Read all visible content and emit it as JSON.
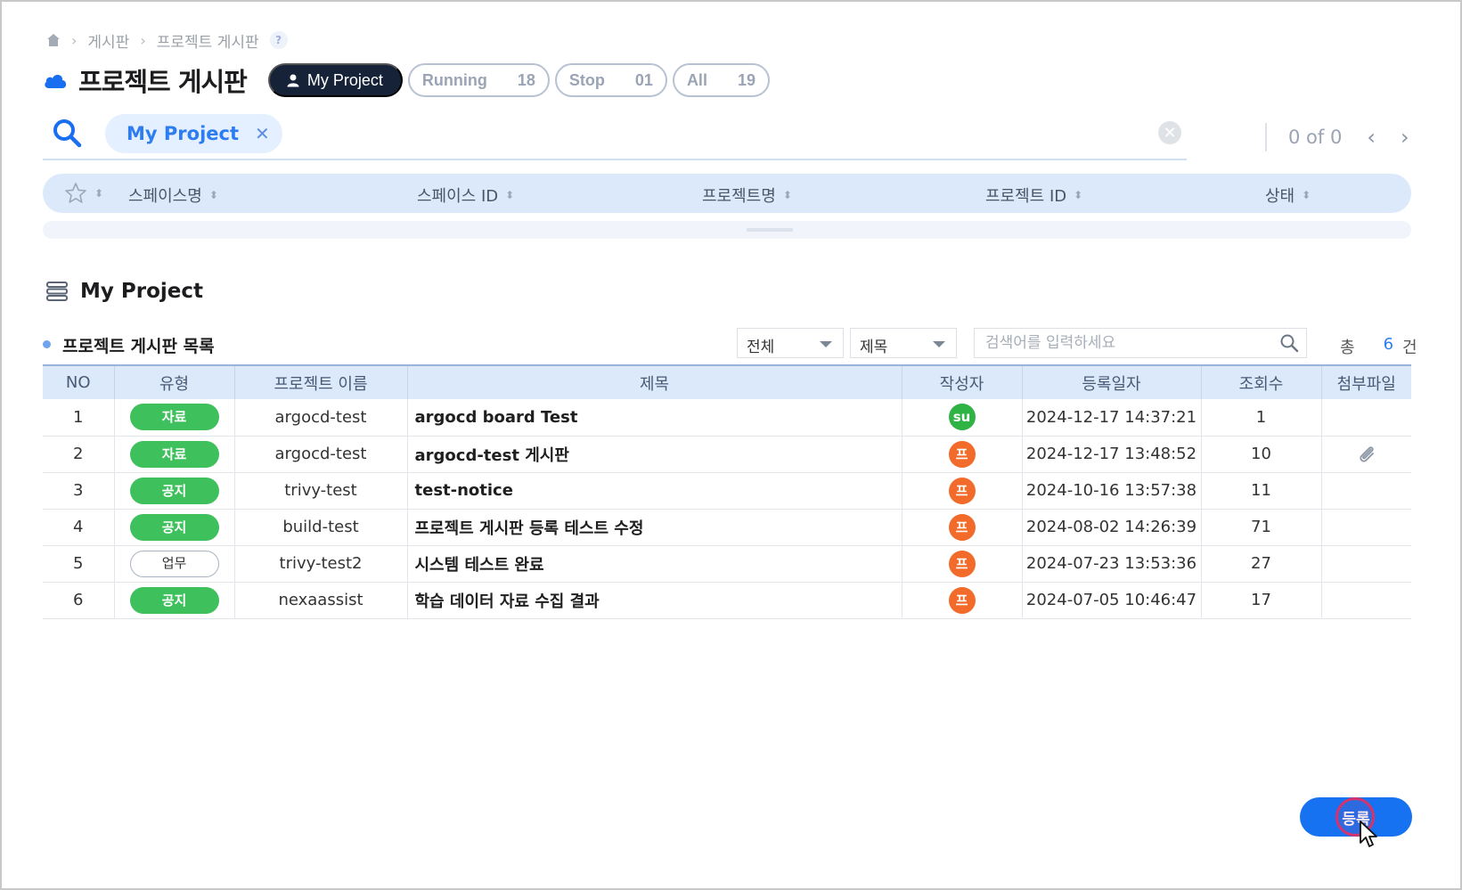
{
  "breadcrumb": {
    "items": [
      "게시판",
      "프로젝트 게시판"
    ],
    "help": "?"
  },
  "header": {
    "title": "프로젝트 게시판",
    "filters": {
      "my_project": "My Project",
      "running": {
        "label": "Running",
        "count": "18"
      },
      "stop": {
        "label": "Stop",
        "count": "01"
      },
      "all": {
        "label": "All",
        "count": "19"
      }
    }
  },
  "search": {
    "chip": "My Project",
    "pager": "0 of 0"
  },
  "columns": {
    "space_name": "스페이스명",
    "space_id": "스페이스 ID",
    "project_name": "프로젝트명",
    "project_id": "프로젝트 ID",
    "status": "상태"
  },
  "section": {
    "title": "My Project",
    "list_label": "프로젝트 게시판 목록",
    "filter_scope": "전체",
    "filter_field": "제목",
    "search_placeholder": "검색어를 입력하세요",
    "total_prefix": "총",
    "total_count": "6",
    "total_suffix": "건"
  },
  "table": {
    "headers": [
      "NO",
      "유형",
      "프로젝트 이름",
      "제목",
      "작성자",
      "등록일자",
      "조회수",
      "첨부파일"
    ],
    "rows": [
      {
        "no": "1",
        "type": "자료",
        "project": "argocd-test",
        "subject": "argocd board Test",
        "author": "su",
        "author_color": "#2fb344",
        "date": "2024-12-17 14:37:21",
        "views": "1",
        "attachment": false
      },
      {
        "no": "2",
        "type": "자료",
        "project": "argocd-test",
        "subject": "argocd-test 게시판",
        "author": "프",
        "author_color": "#f26b2a",
        "date": "2024-12-17 13:48:52",
        "views": "10",
        "attachment": true
      },
      {
        "no": "3",
        "type": "공지",
        "project": "trivy-test",
        "subject": "test-notice",
        "author": "프",
        "author_color": "#f26b2a",
        "date": "2024-10-16 13:57:38",
        "views": "11",
        "attachment": false
      },
      {
        "no": "4",
        "type": "공지",
        "project": "build-test",
        "subject": "프로젝트 게시판 등록 테스트 수정",
        "author": "프",
        "author_color": "#f26b2a",
        "date": "2024-08-02 14:26:39",
        "views": "71",
        "attachment": false
      },
      {
        "no": "5",
        "type": "업무",
        "project": "trivy-test2",
        "subject": "시스템 테스트 완료",
        "author": "프",
        "author_color": "#f26b2a",
        "date": "2024-07-23 13:53:36",
        "views": "27",
        "attachment": false
      },
      {
        "no": "6",
        "type": "공지",
        "project": "nexaassist",
        "subject": "학습 데이터 자료 수집 결과",
        "author": "프",
        "author_color": "#f26b2a",
        "date": "2024-07-05 10:46:47",
        "views": "17",
        "attachment": false
      }
    ]
  },
  "actions": {
    "register": "등록"
  }
}
